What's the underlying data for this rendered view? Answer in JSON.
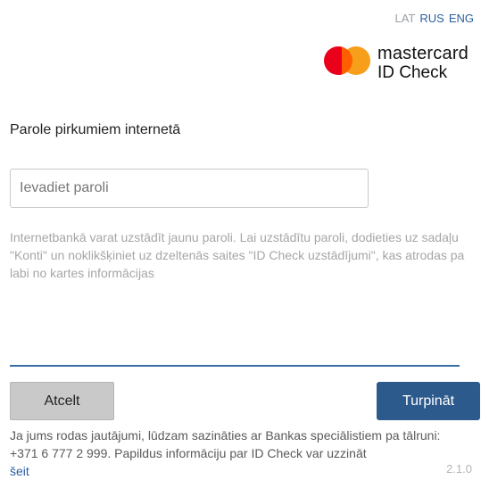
{
  "languages": {
    "lat": "LAT",
    "rus": "RUS",
    "eng": "ENG"
  },
  "brand": {
    "name": "mastercard",
    "product": "ID Check"
  },
  "form": {
    "title": "Parole pirkumiem internetā",
    "password_placeholder": "Ievadiet paroli",
    "info": "Internetbankā varat uzstādīt jaunu paroli. Lai uzstādītu paroli, dodieties uz sadaļu \"Konti\" un noklikšķiniet uz dzeltenās saites \"ID Check uzstādījumi\", kas atrodas pa labi no kartes informācijas"
  },
  "buttons": {
    "cancel": "Atcelt",
    "continue": "Turpināt"
  },
  "footer": {
    "text": "Ja jums rodas jautājumi, lūdzam sazināties ar Bankas speciālistiem pa tālruni: +371 6 777 2 999. Papildus informāciju par ID Check var uzzināt",
    "link": "šeit"
  },
  "version": "2.1.0",
  "colors": {
    "primary": "#2d5a8c",
    "link": "#2a5f9e",
    "mc_red": "#eb001b",
    "mc_yellow": "#f79e1b"
  }
}
